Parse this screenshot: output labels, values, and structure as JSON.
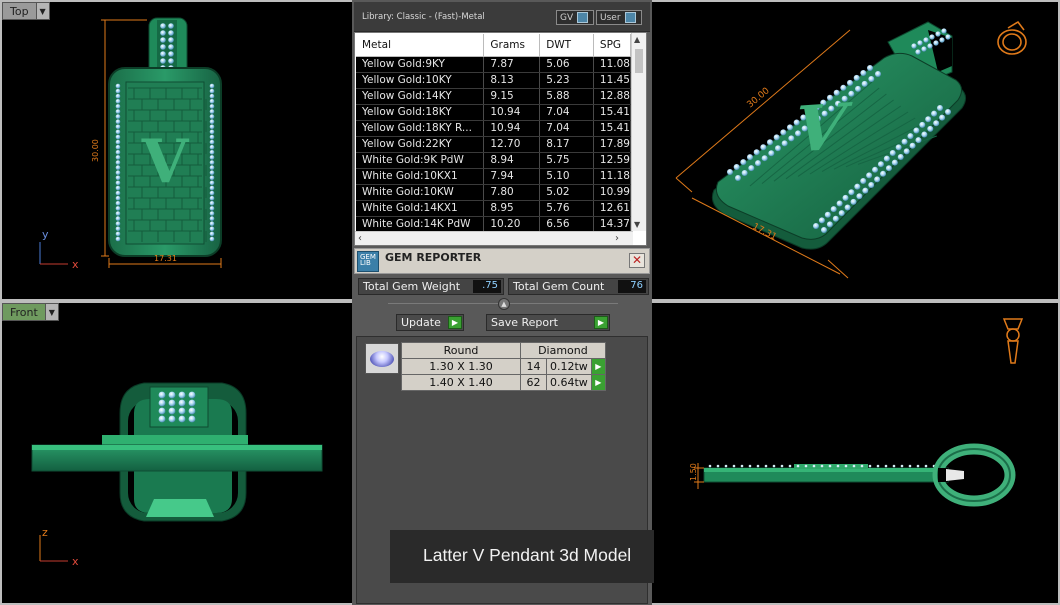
{
  "viewports": {
    "top": {
      "label": "Top",
      "dim_height": "30.00",
      "dim_width": "17.31",
      "axis_y": "y",
      "axis_x": "x",
      "letter": "V"
    },
    "front": {
      "label": "Front",
      "axis_z": "z",
      "axis_x": "x"
    },
    "perspective": {
      "dim_length": "30.00",
      "dim_width": "17.31",
      "letter": "V"
    },
    "right": {
      "dim_thickness": "1.50"
    }
  },
  "library": {
    "title": "Library: Classic - (Fast)-Metal",
    "toggle_gv": "GV",
    "toggle_user": "User",
    "columns": [
      "Metal",
      "Grams",
      "DWT",
      "SPG"
    ],
    "rows": [
      [
        "Yellow Gold:9KY",
        "7.87",
        "5.06",
        "11.08"
      ],
      [
        "Yellow Gold:10KY",
        "8.13",
        "5.23",
        "11.45"
      ],
      [
        "Yellow Gold:14KY",
        "9.15",
        "5.88",
        "12.88"
      ],
      [
        "Yellow Gold:18KY",
        "10.94",
        "7.04",
        "15.41"
      ],
      [
        "Yellow Gold:18KY R...",
        "10.94",
        "7.04",
        "15.41"
      ],
      [
        "Yellow Gold:22KY",
        "12.70",
        "8.17",
        "17.89"
      ],
      [
        "White Gold:9K PdW",
        "8.94",
        "5.75",
        "12.59"
      ],
      [
        "White Gold:10KX1",
        "7.94",
        "5.10",
        "11.18"
      ],
      [
        "White Gold:10KW",
        "7.80",
        "5.02",
        "10.99"
      ],
      [
        "White Gold:14KX1",
        "8.95",
        "5.76",
        "12.61"
      ],
      [
        "White Gold:14K PdW",
        "10.20",
        "6.56",
        "14.37"
      ]
    ]
  },
  "gem_reporter": {
    "title": "GEM REPORTER",
    "icon_text": "GEM LIB",
    "total_weight_label": "Total Gem Weight",
    "total_weight_value": ".75",
    "total_count_label": "Total Gem Count",
    "total_count_value": "76",
    "update_label": "Update",
    "save_label": "Save Report",
    "shape_header": "Round",
    "stone_header": "Diamond",
    "gems": [
      {
        "size": "1.30 X 1.30",
        "count": "14",
        "weight": "0.12tw"
      },
      {
        "size": "1.40 X 1.40",
        "count": "62",
        "weight": "0.64tw"
      }
    ]
  },
  "caption": "Latter V Pendant 3d Model",
  "colors": {
    "model_green": "#1f8a5a",
    "stone_blue": "#8fc8ea",
    "dim_orange": "#e07a1a",
    "accent_go": "#3aa132"
  }
}
